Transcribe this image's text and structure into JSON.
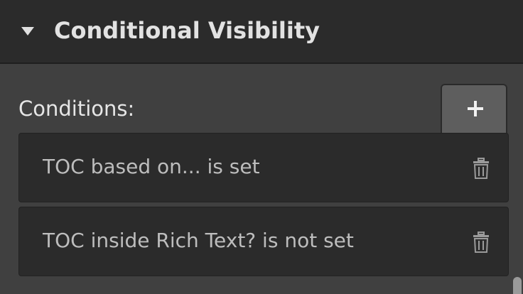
{
  "header": {
    "title": "Conditional Visibility",
    "caret_icon": "caret-down-icon"
  },
  "conditions": {
    "label": "Conditions:",
    "add_icon": "plus-icon",
    "items": [
      {
        "text": "TOC based on... is set",
        "delete_icon": "trash-icon"
      },
      {
        "text": "TOC inside Rich Text? is not set",
        "delete_icon": "trash-icon"
      }
    ]
  },
  "colors": {
    "panel_bg": "#404040",
    "header_bg": "#2b2b2b",
    "row_bg": "#2b2b2b",
    "add_tab_bg": "#5e5e5e"
  }
}
